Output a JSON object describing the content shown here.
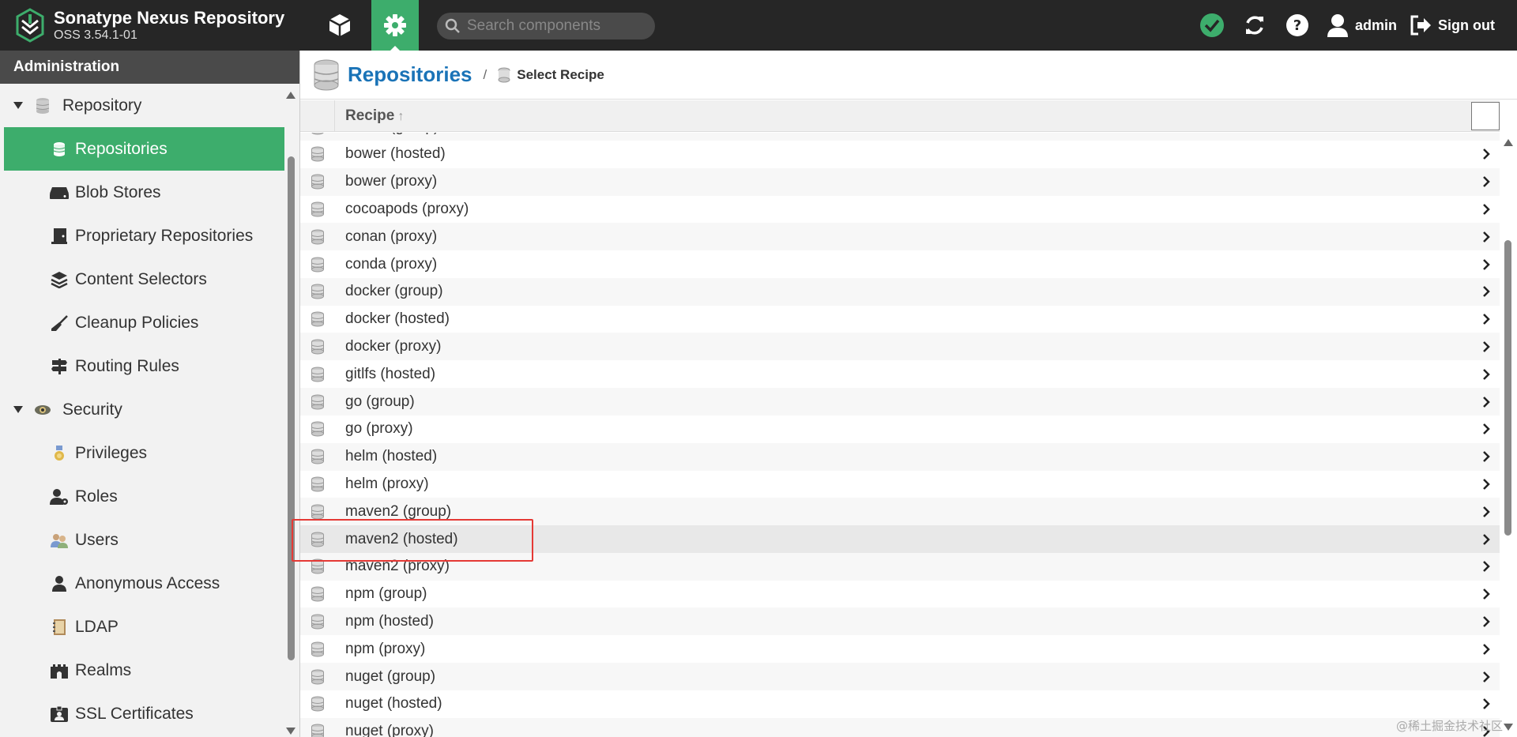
{
  "header": {
    "title": "Sonatype Nexus Repository",
    "version": "OSS 3.54.1-01",
    "search_placeholder": "Search components",
    "user": "admin",
    "signout": "Sign out"
  },
  "sidebar": {
    "header": "Administration",
    "repository_group": "Repository",
    "repository_items": [
      "Repositories",
      "Blob Stores",
      "Proprietary Repositories",
      "Content Selectors",
      "Cleanup Policies",
      "Routing Rules"
    ],
    "security_group": "Security",
    "security_items": [
      "Privileges",
      "Roles",
      "Users",
      "Anonymous Access",
      "LDAP",
      "Realms",
      "SSL Certificates"
    ]
  },
  "breadcrumb": {
    "title": "Repositories",
    "separator": "/",
    "sub": "Select Recipe"
  },
  "grid": {
    "column": "Recipe",
    "sort_arrow": "↑",
    "rows": [
      "bower (group)",
      "bower (hosted)",
      "bower (proxy)",
      "cocoapods (proxy)",
      "conan (proxy)",
      "conda (proxy)",
      "docker (group)",
      "docker (hosted)",
      "docker (proxy)",
      "gitlfs (hosted)",
      "go (group)",
      "go (proxy)",
      "helm (hosted)",
      "helm (proxy)",
      "maven2 (group)",
      "maven2 (hosted)",
      "maven2 (proxy)",
      "npm (group)",
      "npm (hosted)",
      "npm (proxy)",
      "nuget (group)",
      "nuget (hosted)",
      "nuget (proxy)"
    ],
    "highlighted_row": "maven2 (hosted)"
  },
  "watermark": "@稀土掘金技术社区",
  "colors": {
    "header_bg": "#262626",
    "accent_green": "#3dad6c",
    "title_blue": "#1a73b7",
    "highlight_red": "#e53935"
  }
}
